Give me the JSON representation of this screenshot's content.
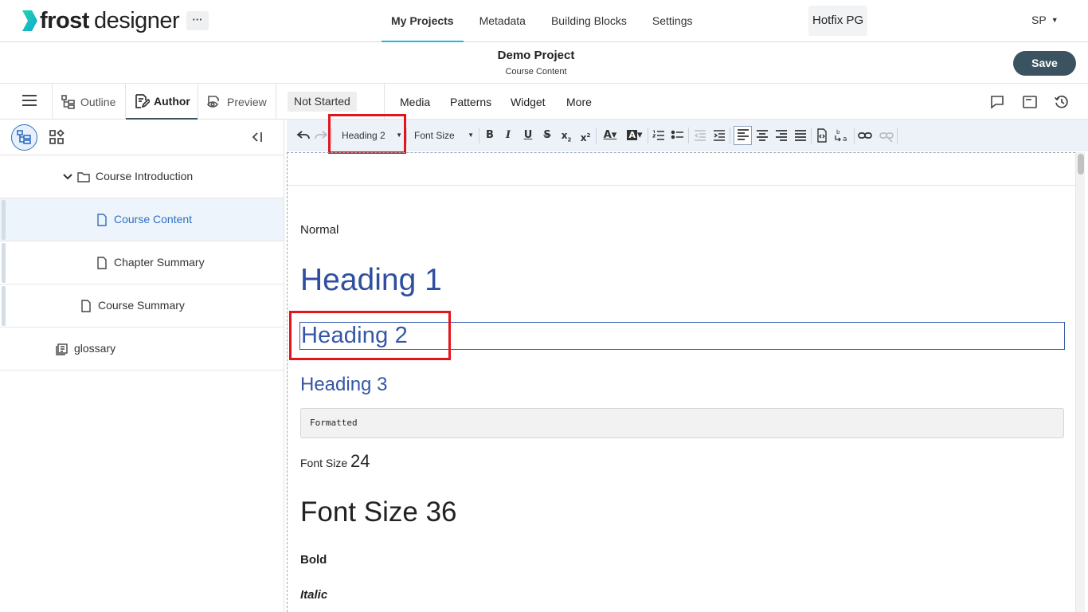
{
  "topnav": {
    "logo_bold": "frost",
    "logo_light": "designer",
    "more_label": "···",
    "links": [
      "My Projects",
      "Metadata",
      "Building Blocks",
      "Settings"
    ],
    "org": "Hotfix PG",
    "user": "SP"
  },
  "project": {
    "title": "Demo Project",
    "subtitle": "Course Content",
    "save_label": "Save"
  },
  "modebar": {
    "tabs": [
      "Outline",
      "Author",
      "Preview"
    ],
    "active_tab": "Author",
    "status": "Not Started",
    "insert_menus": [
      "Media",
      "Patterns",
      "Widget",
      "More"
    ]
  },
  "tree": {
    "items": [
      {
        "label": "Course Introduction",
        "icon": "folder-icon"
      },
      {
        "label": "Course Content",
        "icon": "page-icon",
        "selected": true
      },
      {
        "label": "Chapter Summary",
        "icon": "page-icon"
      },
      {
        "label": "Course Summary",
        "icon": "page-icon"
      },
      {
        "label": "glossary",
        "icon": "glossary-icon"
      }
    ]
  },
  "toolbar": {
    "block_format": "Heading 2",
    "font_size": "Font Size"
  },
  "content": {
    "normal": "Normal",
    "h1": "Heading 1",
    "h2": "Heading 2",
    "h3": "Heading 3",
    "formatted": "Formatted",
    "fs24_prefix": "Font Size",
    "fs24_value": "24",
    "fs36": "Font Size 36",
    "bold": "Bold",
    "italic": "Italic"
  },
  "colors": {
    "accent": "#27b6d3",
    "save_bg": "#3b5360",
    "heading": "#2e4ea0",
    "highlight": "#e3141b",
    "logo": "#1fd5a8"
  }
}
